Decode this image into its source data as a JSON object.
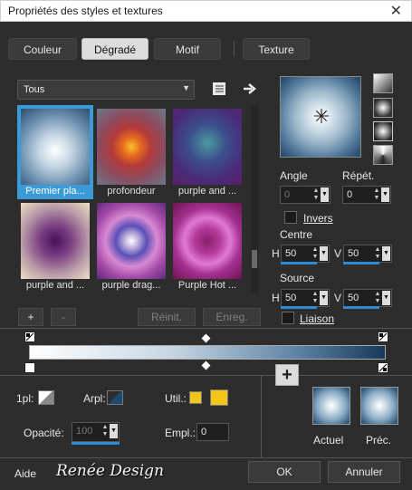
{
  "window": {
    "title": "Propriétés des styles et textures",
    "close_glyph": "✕"
  },
  "tabs": [
    {
      "label": "Couleur"
    },
    {
      "label": "Dégradé",
      "active": true
    },
    {
      "label": "Motif"
    },
    {
      "label": "Texture"
    }
  ],
  "library": {
    "category": "Tous",
    "items": [
      {
        "label": "Premier pla...",
        "selected": true
      },
      {
        "label": "profondeur"
      },
      {
        "label": "purple and ..."
      },
      {
        "label": "purple and ..."
      },
      {
        "label": "purple drag..."
      },
      {
        "label": "Purple Hot ..."
      }
    ]
  },
  "gallery_buttons": {
    "add": "+",
    "remove": "-",
    "reset": "Réinit.",
    "save": "Enreg."
  },
  "angle": {
    "label": "Angle",
    "value": "0"
  },
  "repeat": {
    "label": "Répét.",
    "value": "0"
  },
  "invert": {
    "label": "Invers",
    "checked": false
  },
  "center": {
    "label": "Centre",
    "h_label": "H",
    "h": "50",
    "v_label": "V",
    "v": "50"
  },
  "source": {
    "label": "Source",
    "h_label": "H",
    "h": "50",
    "v_label": "V",
    "v": "50"
  },
  "link": {
    "label": "Liaison",
    "checked": false
  },
  "stops": {
    "first_label": "1pl:",
    "bg_label": "Arpl:",
    "user_label": "Util.:",
    "user_color": "#f2c51a",
    "opacity_label": "Opacité:",
    "opacity": "100",
    "location_label": "Empl.:",
    "location": "0"
  },
  "samples": {
    "current_label": "Actuel",
    "previous_label": "Préc."
  },
  "footer": {
    "help": "Aide",
    "logo_text": "Renée Design",
    "ok": "OK",
    "cancel": "Annuler"
  }
}
